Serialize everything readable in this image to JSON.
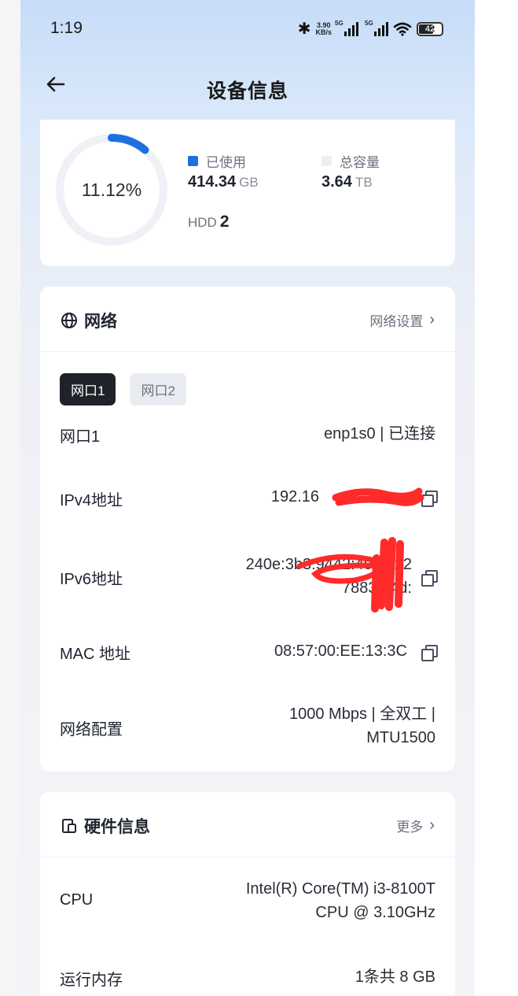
{
  "status_bar": {
    "time": "1:19",
    "speed_value": "3.90",
    "speed_unit": "KB/s",
    "net1": "5G",
    "net2": "5G",
    "battery": "42"
  },
  "header": {
    "title": "设备信息"
  },
  "storage": {
    "percent_label": "11.12%",
    "used_fraction": 0.1112,
    "used_label": "已使用",
    "used_value": "414.34",
    "used_unit": "GB",
    "total_label": "总容量",
    "total_value": "3.64",
    "total_unit": "TB",
    "hdd_label": "HDD",
    "hdd_count": "2",
    "colors": {
      "used": "#1f6fe0",
      "total": "#eceef1",
      "track": "#eef1f5"
    }
  },
  "network": {
    "title": "网络",
    "settings_link": "网络设置",
    "tabs": [
      {
        "label": "网口1",
        "active": true
      },
      {
        "label": "网口2",
        "active": false
      }
    ],
    "rows": {
      "port": {
        "key": "网口1",
        "value": "enp1s0 | 已连接"
      },
      "ipv4": {
        "key": "IPv4地址",
        "value": "192.16"
      },
      "ipv6": {
        "key": "IPv6地址",
        "value_line1": "240e:3b3:9442:4980:22",
        "value_line2": "7883:24d:"
      },
      "mac": {
        "key": "MAC 地址",
        "value": "08:57:00:EE:13:3C"
      },
      "config": {
        "key": "网络配置",
        "value_line1": "1000 Mbps | 全双工 |",
        "value_line2": "MTU1500"
      }
    }
  },
  "hardware": {
    "title": "硬件信息",
    "more_link": "更多",
    "rows": {
      "cpu": {
        "key": "CPU",
        "value_line1": "Intel(R) Core(TM) i3-8100T",
        "value_line2": "CPU @ 3.10GHz"
      },
      "memory": {
        "key": "运行内存",
        "value": "1条共 8 GB"
      }
    }
  }
}
